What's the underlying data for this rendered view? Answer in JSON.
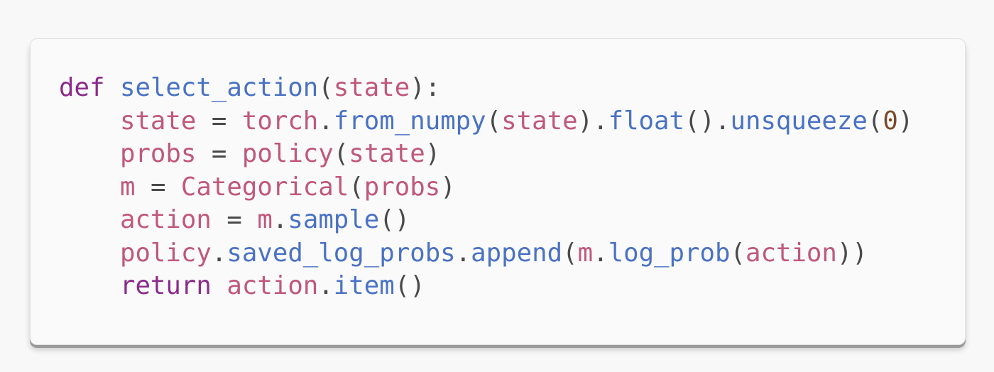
{
  "code": {
    "language": "python",
    "lines": [
      [
        {
          "text": "def",
          "kind": "kw"
        },
        {
          "text": " ",
          "kind": "pun"
        },
        {
          "text": "select_action",
          "kind": "fn"
        },
        {
          "text": "(",
          "kind": "pun"
        },
        {
          "text": "state",
          "kind": "var"
        },
        {
          "text": "):",
          "kind": "pun"
        }
      ],
      [
        {
          "text": "    ",
          "kind": "pun"
        },
        {
          "text": "state",
          "kind": "var"
        },
        {
          "text": " = ",
          "kind": "pun"
        },
        {
          "text": "torch",
          "kind": "var"
        },
        {
          "text": ".",
          "kind": "pun"
        },
        {
          "text": "from_numpy",
          "kind": "fn"
        },
        {
          "text": "(",
          "kind": "pun"
        },
        {
          "text": "state",
          "kind": "var"
        },
        {
          "text": ").",
          "kind": "pun"
        },
        {
          "text": "float",
          "kind": "fn"
        },
        {
          "text": "().",
          "kind": "pun"
        },
        {
          "text": "unsqueeze",
          "kind": "fn"
        },
        {
          "text": "(",
          "kind": "pun"
        },
        {
          "text": "0",
          "kind": "num"
        },
        {
          "text": ")",
          "kind": "pun"
        }
      ],
      [
        {
          "text": "    ",
          "kind": "pun"
        },
        {
          "text": "probs",
          "kind": "var"
        },
        {
          "text": " = ",
          "kind": "pun"
        },
        {
          "text": "policy",
          "kind": "var"
        },
        {
          "text": "(",
          "kind": "pun"
        },
        {
          "text": "state",
          "kind": "var"
        },
        {
          "text": ")",
          "kind": "pun"
        }
      ],
      [
        {
          "text": "    ",
          "kind": "pun"
        },
        {
          "text": "m",
          "kind": "var"
        },
        {
          "text": " = ",
          "kind": "pun"
        },
        {
          "text": "Categorical",
          "kind": "var"
        },
        {
          "text": "(",
          "kind": "pun"
        },
        {
          "text": "probs",
          "kind": "var"
        },
        {
          "text": ")",
          "kind": "pun"
        }
      ],
      [
        {
          "text": "    ",
          "kind": "pun"
        },
        {
          "text": "action",
          "kind": "var"
        },
        {
          "text": " = ",
          "kind": "pun"
        },
        {
          "text": "m",
          "kind": "var"
        },
        {
          "text": ".",
          "kind": "pun"
        },
        {
          "text": "sample",
          "kind": "fn"
        },
        {
          "text": "()",
          "kind": "pun"
        }
      ],
      [
        {
          "text": "    ",
          "kind": "pun"
        },
        {
          "text": "policy",
          "kind": "var"
        },
        {
          "text": ".",
          "kind": "pun"
        },
        {
          "text": "saved_log_probs",
          "kind": "fn"
        },
        {
          "text": ".",
          "kind": "pun"
        },
        {
          "text": "append",
          "kind": "fn"
        },
        {
          "text": "(",
          "kind": "pun"
        },
        {
          "text": "m",
          "kind": "var"
        },
        {
          "text": ".",
          "kind": "pun"
        },
        {
          "text": "log_prob",
          "kind": "fn"
        },
        {
          "text": "(",
          "kind": "pun"
        },
        {
          "text": "action",
          "kind": "var"
        },
        {
          "text": "))",
          "kind": "pun"
        }
      ],
      [
        {
          "text": "    ",
          "kind": "pun"
        },
        {
          "text": "return",
          "kind": "kw"
        },
        {
          "text": " ",
          "kind": "pun"
        },
        {
          "text": "action",
          "kind": "var"
        },
        {
          "text": ".",
          "kind": "pun"
        },
        {
          "text": "item",
          "kind": "fn"
        },
        {
          "text": "()",
          "kind": "pun"
        }
      ]
    ]
  },
  "colors": {
    "keyword": "#8b2b8c",
    "function": "#4a72c4",
    "variable": "#c0587a",
    "punctuation": "#4a4a4a",
    "number": "#7a4a2a",
    "card_background": "#fafafa",
    "page_background": "#f8f8f8"
  }
}
